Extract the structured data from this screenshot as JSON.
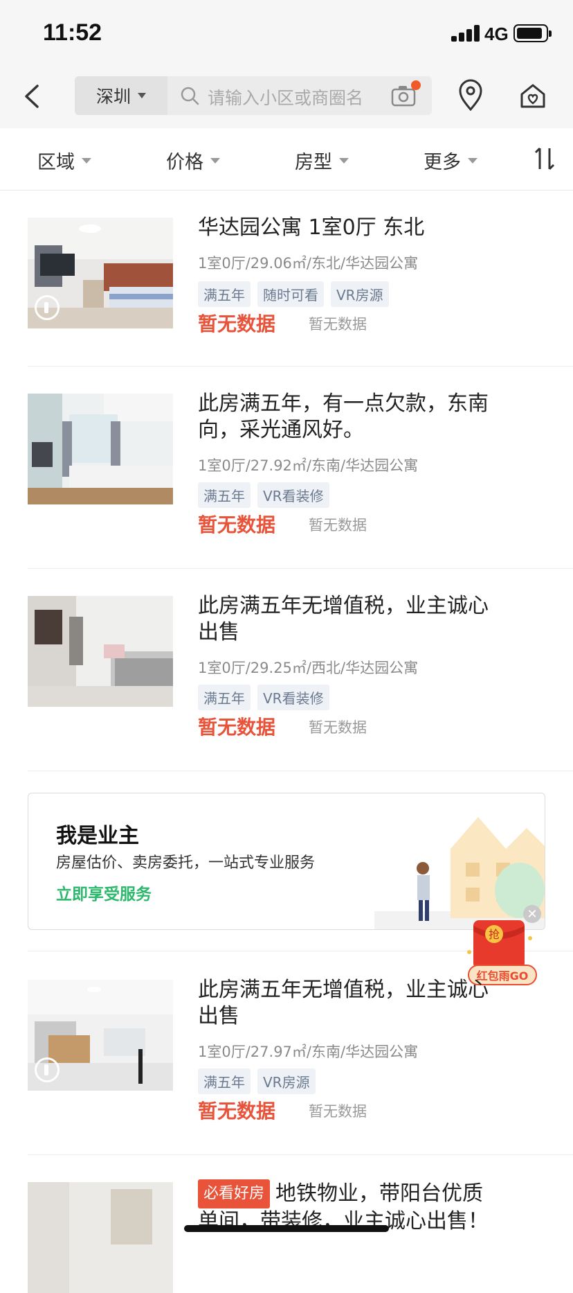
{
  "status_bar": {
    "time": "11:52",
    "network": "4G"
  },
  "header": {
    "city": "深圳",
    "search_placeholder": "请输入小区或商圈名"
  },
  "filters": [
    {
      "label": "区域"
    },
    {
      "label": "价格"
    },
    {
      "label": "房型"
    },
    {
      "label": "更多"
    }
  ],
  "listings": [
    {
      "title": "华达园公寓 1室0厅 东北",
      "meta": "1室0厅/29.06㎡/东北/华达园公寓",
      "tags": [
        "满五年",
        "随时可看",
        "VR房源"
      ],
      "price": "暂无数据",
      "unit_price": "暂无数据"
    },
    {
      "title": "此房满五年，有一点欠款，东南向，采光通风好。",
      "meta": "1室0厅/27.92㎡/东南/华达园公寓",
      "tags": [
        "满五年",
        "VR看装修"
      ],
      "price": "暂无数据",
      "unit_price": "暂无数据"
    },
    {
      "title": "此房满五年无增值税，业主诚心出售",
      "meta": "1室0厅/29.25㎡/西北/华达园公寓",
      "tags": [
        "满五年",
        "VR看装修"
      ],
      "price": "暂无数据",
      "unit_price": "暂无数据"
    },
    {
      "title": "此房满五年无增值税，业主诚心出售",
      "meta": "1室0厅/27.97㎡/东南/华达园公寓",
      "tags": [
        "满五年",
        "VR房源"
      ],
      "price": "暂无数据",
      "unit_price": "暂无数据"
    },
    {
      "badge": "必看好房",
      "title": "地铁物业，带阳台优质单间，带装修，业主诚心出售！"
    }
  ],
  "owner_banner": {
    "title": "我是业主",
    "subtitle": "房屋估价、卖房委托，一站式专业服务",
    "cta": "立即享受服务"
  },
  "red_packet": {
    "icon_text": "抢",
    "label": "红包雨GO"
  }
}
